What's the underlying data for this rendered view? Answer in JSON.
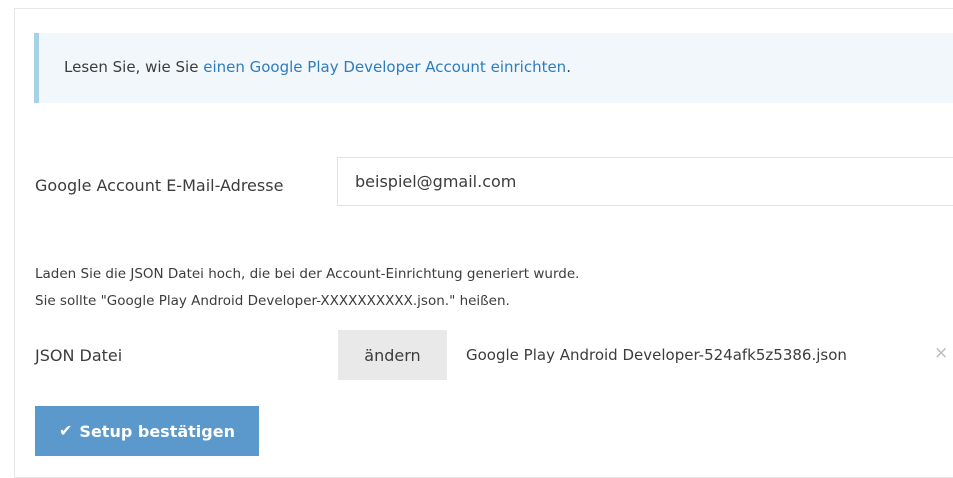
{
  "info": {
    "prefix": "Lesen Sie, wie Sie ",
    "link_text": "einen Google Play Developer Account einrichten",
    "suffix": "."
  },
  "email": {
    "label": "Google Account E-Mail-Adresse",
    "value": "beispiel@gmail.com"
  },
  "help": {
    "line1": "Laden Sie die JSON Datei hoch, die bei der Account-Einrichtung generiert wurde.",
    "line2": "Sie sollte \"Google Play Android Developer-XXXXXXXXXX.json.\" heißen."
  },
  "json_file": {
    "label": "JSON Datei",
    "change_label": "ändern",
    "file_name": "Google Play Android Developer-524afk5z5386.json",
    "remove_glyph": "×"
  },
  "confirm": {
    "icon_glyph": "✔",
    "label": "Setup bestätigen"
  },
  "colors": {
    "link": "#2e7cc0",
    "info_background": "#f1f7fb",
    "info_border": "#a6d2e8",
    "primary_button": "#5b98cc",
    "secondary_button": "#e9e9e9"
  },
  "icons": {
    "confirm": "check-icon",
    "remove": "close-icon"
  }
}
